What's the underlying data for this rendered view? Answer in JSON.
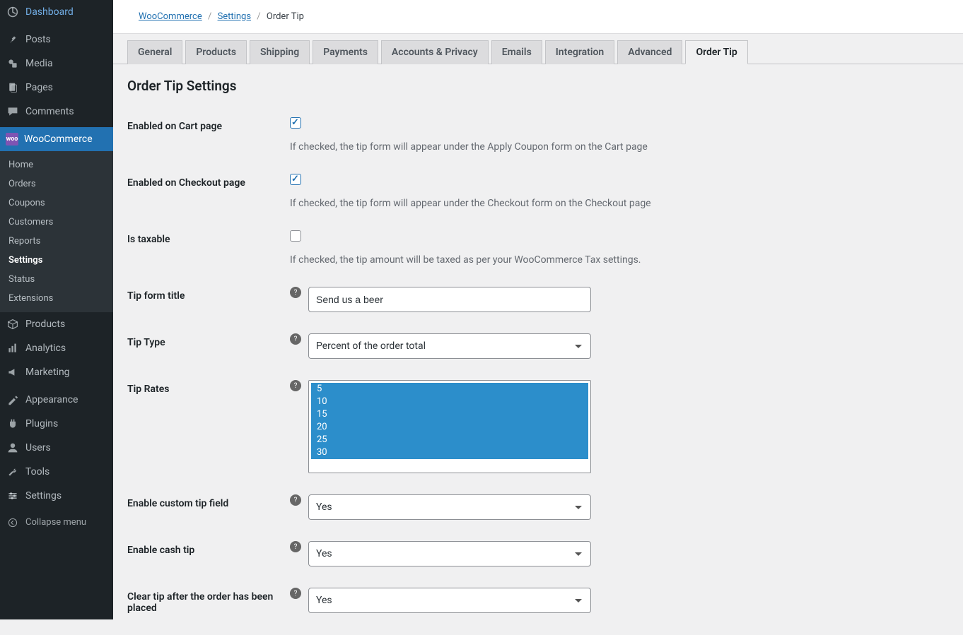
{
  "sidebar": {
    "items": [
      {
        "label": "Dashboard"
      },
      {
        "label": "Posts"
      },
      {
        "label": "Media"
      },
      {
        "label": "Pages"
      },
      {
        "label": "Comments"
      },
      {
        "label": "WooCommerce"
      },
      {
        "label": "Products"
      },
      {
        "label": "Analytics"
      },
      {
        "label": "Marketing"
      },
      {
        "label": "Appearance"
      },
      {
        "label": "Plugins"
      },
      {
        "label": "Users"
      },
      {
        "label": "Tools"
      },
      {
        "label": "Settings"
      }
    ],
    "submenu": [
      {
        "label": "Home"
      },
      {
        "label": "Orders"
      },
      {
        "label": "Coupons"
      },
      {
        "label": "Customers"
      },
      {
        "label": "Reports"
      },
      {
        "label": "Settings"
      },
      {
        "label": "Status"
      },
      {
        "label": "Extensions"
      }
    ],
    "collapse": "Collapse menu"
  },
  "breadcrumb": {
    "a": "WooCommerce",
    "b": "Settings",
    "c": "Order Tip"
  },
  "tabs": [
    "General",
    "Products",
    "Shipping",
    "Payments",
    "Accounts & Privacy",
    "Emails",
    "Integration",
    "Advanced",
    "Order Tip"
  ],
  "page_title": "Order Tip Settings",
  "fields": {
    "enabled_cart": {
      "label": "Enabled on Cart page",
      "desc": "If checked, the tip form will appear under the Apply Coupon form on the Cart page",
      "checked": true
    },
    "enabled_checkout": {
      "label": "Enabled on Checkout page",
      "desc": "If checked, the tip form will appear under the Checkout form on the Checkout page",
      "checked": true
    },
    "is_taxable": {
      "label": "Is taxable",
      "desc": "If checked, the tip amount will be taxed as per your WooCommerce Tax settings.",
      "checked": false
    },
    "tip_title": {
      "label": "Tip form title",
      "value": "Send us a beer"
    },
    "tip_type": {
      "label": "Tip Type",
      "value": "Percent of the order total"
    },
    "tip_rates": {
      "label": "Tip Rates",
      "options": [
        "5",
        "10",
        "15",
        "20",
        "25",
        "30"
      ]
    },
    "custom_tip": {
      "label": "Enable custom tip field",
      "value": "Yes"
    },
    "cash_tip": {
      "label": "Enable cash tip",
      "value": "Yes"
    },
    "clear_tip": {
      "label": "Clear tip after the order has been placed",
      "value": "Yes"
    }
  },
  "woo_badge": "woo"
}
